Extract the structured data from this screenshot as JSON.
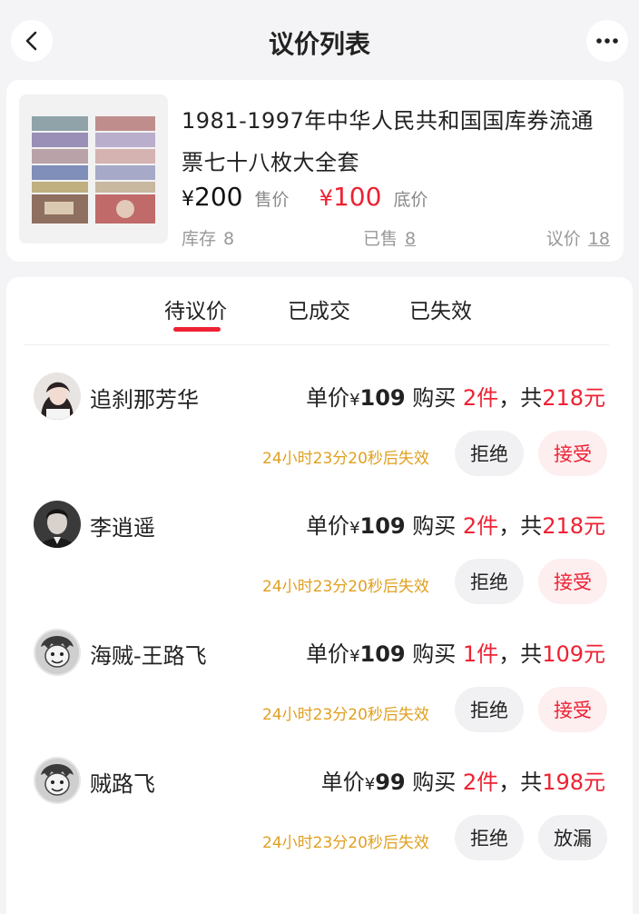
{
  "header": {
    "title": "议价列表"
  },
  "product": {
    "title_line1": "1981-1997年中华人民共和国国库券流通",
    "title_line2": "票七十八枚大全套",
    "currency": "¥",
    "sale_price": "200",
    "sale_price_label": "售价",
    "floor_price": "100",
    "floor_price_label": "底价",
    "stock_label": "库存",
    "stock": "8",
    "sold_label": "已售",
    "sold": "8",
    "offers_label": "议价",
    "offers": "18"
  },
  "tabs": [
    {
      "label": "待议价",
      "active": true
    },
    {
      "label": "已成交",
      "active": false
    },
    {
      "label": "已失效",
      "active": false
    }
  ],
  "offers": [
    {
      "buyer": "追刹那芳华",
      "unit_prefix": "单价",
      "currency": "¥",
      "unit_price": "109",
      "buy_label": "购买",
      "qty": "2件",
      "total_prefix": "，共",
      "total": "218元",
      "countdown": "24小时23分20秒后失效",
      "reject_label": "拒绝",
      "action_label": "接受"
    },
    {
      "buyer": "李逍遥",
      "unit_prefix": "单价",
      "currency": "¥",
      "unit_price": "109",
      "buy_label": "购买",
      "qty": "2件",
      "total_prefix": "，共",
      "total": "218元",
      "countdown": "24小时23分20秒后失效",
      "reject_label": "拒绝",
      "action_label": "接受"
    },
    {
      "buyer": "海贼-王路飞",
      "unit_prefix": "单价",
      "currency": "¥",
      "unit_price": "109",
      "buy_label": "购买",
      "qty": "1件",
      "total_prefix": "，共",
      "total": "109元",
      "countdown": "24小时23分20秒后失效",
      "reject_label": "拒绝",
      "action_label": "接受"
    },
    {
      "buyer": "贼路飞",
      "unit_prefix": "单价",
      "currency": "¥",
      "unit_price": "99",
      "buy_label": "购买",
      "qty": "2件",
      "total_prefix": "，共",
      "total": "198元",
      "countdown": "24小时23分20秒后失效",
      "reject_label": "拒绝",
      "action_label": "放漏"
    }
  ],
  "colors": {
    "accent": "#ee2233",
    "countdown": "#e0a020",
    "background": "#f4f4f6"
  },
  "icons": {
    "back": "chevron-left-icon",
    "more": "more-dots-icon"
  }
}
